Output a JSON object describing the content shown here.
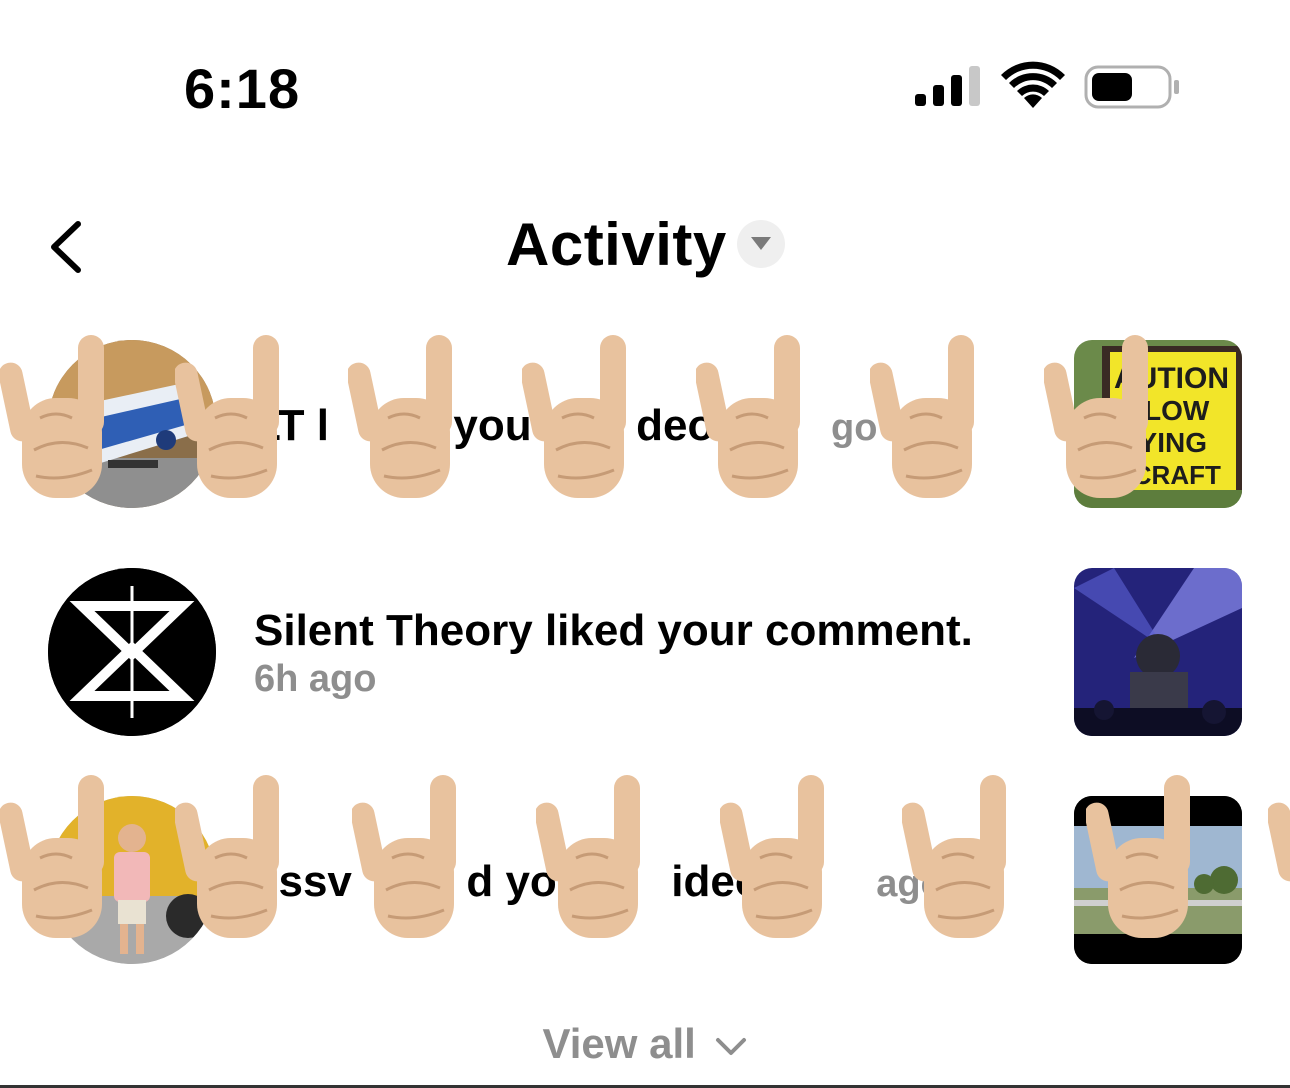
{
  "status_bar": {
    "time": "6:18"
  },
  "header": {
    "title": "Activity",
    "back_icon": "chevron-left-icon",
    "dropdown_icon": "caret-down-icon"
  },
  "activity": [
    {
      "text": "LT l",
      "text_mid": "you",
      "text_end": "deo.",
      "time": "go",
      "avatar": "airplane-photo",
      "thumbnail": "caution-low-flying-aircraft-sign",
      "thumbnail_sign_lines": [
        "AUTION",
        "LOW",
        "LYING",
        "RCRAFT"
      ]
    },
    {
      "text": "Silent Theory liked your comment.",
      "time": "6h ago",
      "avatar": "silent-theory-logo",
      "thumbnail": "concert-photo"
    },
    {
      "text": "essv",
      "text_mid": "d yo",
      "text_end": "ideo",
      "time": "ago",
      "avatar": "person-with-aircraft-photo",
      "thumbnail": "runway-video-frame"
    }
  ],
  "footer": {
    "view_all": "View all",
    "view_all_icon": "chevron-down-icon"
  },
  "overlay": {
    "emoji": "sign-of-the-horns-emoji",
    "skin_tone": "#e8c29e"
  }
}
